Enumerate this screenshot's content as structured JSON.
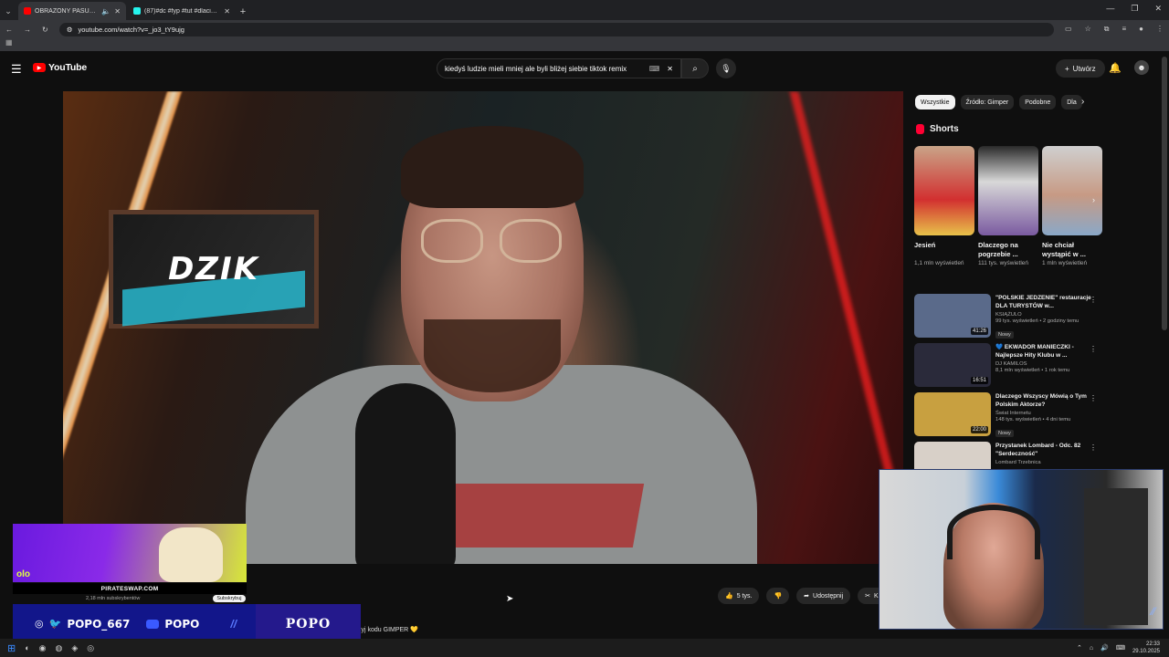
{
  "browser": {
    "tabs": [
      {
        "title": "OBRAŻONY PASUT ATAKUJE",
        "active": true,
        "fav_color": "#ff0000"
      },
      {
        "title": "(87)#dc #fyp #tut #dlaciebie #",
        "active": false,
        "fav_color": "#25f4ee"
      }
    ],
    "url": "youtube.com/watch?v=_jo3_tY9ujg"
  },
  "youtube": {
    "logo": "YouTube",
    "search_query": "kiedyś ludzie mieli mniej ale byli bliżej siebie tiktok remix",
    "create_label": "Utwórz"
  },
  "video": {
    "poster_text": "DZIK",
    "likes": "5 tys.",
    "share_label": "Udostępnij",
    "clip_label": "Klip",
    "description_fragment": "żyj kodu GIMPER 💛"
  },
  "chips": [
    "Wszystkie",
    "Źródło: Gimper",
    "Podobne",
    "Dla"
  ],
  "shorts": {
    "title": "Shorts",
    "items": [
      {
        "name": "Jesień",
        "meta": "1,1 mln wyświetleń"
      },
      {
        "name": "Dlaczego na pogrzebie ...",
        "meta": "111 tys. wyświetleń"
      },
      {
        "name": "Nie chciał wystąpić w ...",
        "meta": "1 mln wyświetleń"
      }
    ]
  },
  "recommendations": [
    {
      "title": "\"POLSKIE JEDZENIE\" restauracje DLA TURYSTÓW w...",
      "channel": "KSIĄŻULO",
      "stats": "99 tys. wyświetleń • 2 godziny temu",
      "duration": "41:26",
      "badge": "Nowy",
      "thumb": "#5a6a8a"
    },
    {
      "title": "💙 EKWADOR MANIECZKI - Najlepsze Hity Klubu w ...",
      "channel": "DJ KAMILOS",
      "stats": "8,1 mln wyświetleń • 1 rok temu",
      "duration": "16:51",
      "badge": "",
      "thumb": "#2a2a3a"
    },
    {
      "title": "Dlaczego Wszyscy Mówią o Tym Polskim Aktorze?",
      "channel": "Świat Internetu",
      "stats": "148 tys. wyświetleń • 4 dni temu",
      "duration": "22:00",
      "badge": "Nowy",
      "thumb": "#c8a040"
    },
    {
      "title": "Przystanek Lombard - Odc. 82 \"Serdeczność\"",
      "channel": "Lombard Trzebnica",
      "stats": "",
      "duration": "",
      "badge": "",
      "thumb": "#d8d0c8"
    }
  ],
  "overlay": {
    "promo_text": "olo",
    "promo_site": "PIRATESWAP.COM",
    "subs": "2,18 mln subskrybentów",
    "subscribe_label": "Subskrybuj",
    "social_handle": "POPO_667",
    "youtube_handle": "POPO",
    "brand": "POPO"
  },
  "taskbar": {
    "time": "22:33",
    "date": "29.10.2025"
  }
}
